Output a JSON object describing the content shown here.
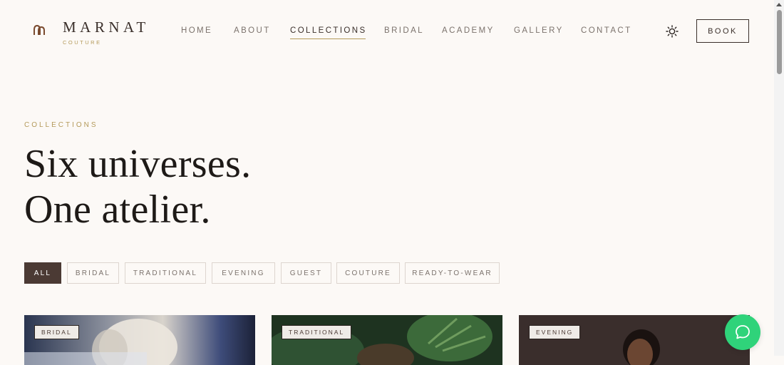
{
  "brand": {
    "name": "MARNAT",
    "sub": "COUTURE"
  },
  "nav": [
    {
      "label": "HOME"
    },
    {
      "label": "ABOUT"
    },
    {
      "label": "COLLECTIONS"
    },
    {
      "label": "BRIDAL"
    },
    {
      "label": "ACADEMY"
    },
    {
      "label": "GALLERY"
    },
    {
      "label": "CONTACT"
    }
  ],
  "nav_active": "COLLECTIONS",
  "header": {
    "book_label": "BOOK",
    "theme_icon": "sun-icon"
  },
  "hero": {
    "eyebrow": "COLLECTIONS",
    "line1": "Six universes.",
    "line2": "One atelier."
  },
  "filters": [
    {
      "label": "ALL",
      "active": true
    },
    {
      "label": "BRIDAL"
    },
    {
      "label": "TRADITIONAL"
    },
    {
      "label": "EVENING"
    },
    {
      "label": "GUEST"
    },
    {
      "label": "COUTURE"
    },
    {
      "label": "READY-TO-WEAR"
    }
  ],
  "cards": [
    {
      "tag": "BRIDAL"
    },
    {
      "tag": "TRADITIONAL"
    },
    {
      "tag": "EVENING"
    }
  ],
  "chat": {
    "icon": "chat-bubble-icon"
  },
  "colors": {
    "accent": "#b49a5a",
    "dark": "#4b3a34",
    "background": "#fcf9f6",
    "chat": "#2fd37a"
  }
}
